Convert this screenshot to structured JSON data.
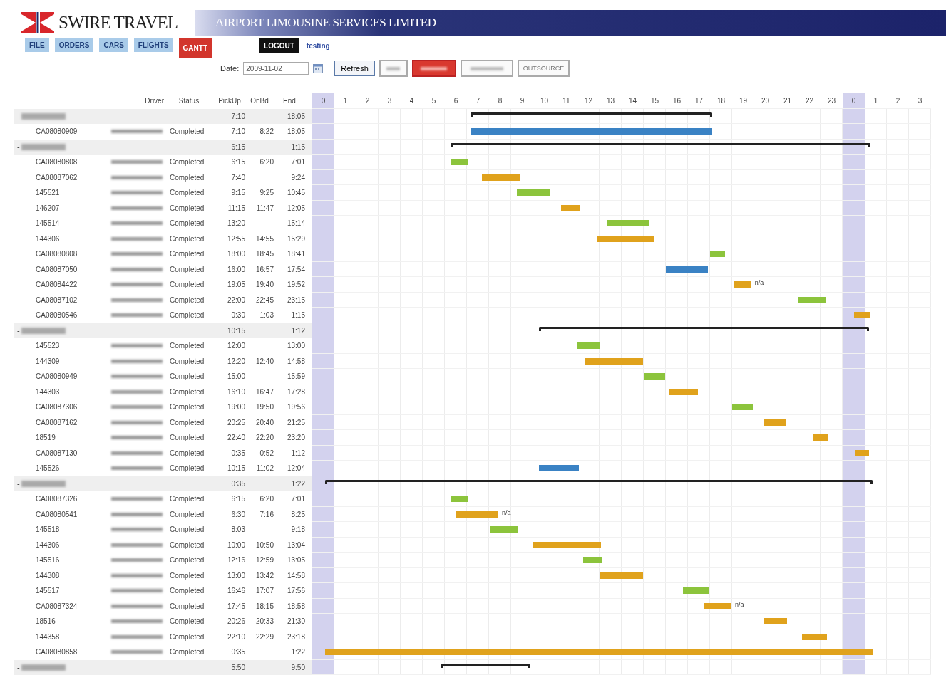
{
  "brand": {
    "name": "SWIRE TRAVEL",
    "banner": "AIRPORT LIMOUSINE SERVICES LIMITED"
  },
  "tabs": [
    {
      "label": "FILE",
      "selected": false
    },
    {
      "label": "ORDERS",
      "selected": false
    },
    {
      "label": "CARS",
      "selected": false
    },
    {
      "label": "FLIGHTS",
      "selected": false
    },
    {
      "label": "GANTT",
      "selected": true
    }
  ],
  "logout": "LOGOUT",
  "user": "testing",
  "toolbar": {
    "date_label": "Date:",
    "date_value": "2009-11-02",
    "refresh": "Refresh",
    "outsource": "OUTSOURCE"
  },
  "columns": [
    "Driver",
    "Status",
    "PickUp",
    "OnBd",
    "End"
  ],
  "hours": [
    {
      "label": "0",
      "highlighted": true
    },
    {
      "label": "1",
      "highlighted": false
    },
    {
      "label": "2",
      "highlighted": false
    },
    {
      "label": "3",
      "highlighted": false
    },
    {
      "label": "4",
      "highlighted": false
    },
    {
      "label": "5",
      "highlighted": false
    },
    {
      "label": "6",
      "highlighted": false
    },
    {
      "label": "7",
      "highlighted": false
    },
    {
      "label": "8",
      "highlighted": false
    },
    {
      "label": "9",
      "highlighted": false
    },
    {
      "label": "10",
      "highlighted": false
    },
    {
      "label": "11",
      "highlighted": false
    },
    {
      "label": "12",
      "highlighted": false
    },
    {
      "label": "13",
      "highlighted": false
    },
    {
      "label": "14",
      "highlighted": false
    },
    {
      "label": "15",
      "highlighted": false
    },
    {
      "label": "16",
      "highlighted": false
    },
    {
      "label": "17",
      "highlighted": false
    },
    {
      "label": "18",
      "highlighted": false
    },
    {
      "label": "19",
      "highlighted": false
    },
    {
      "label": "20",
      "highlighted": false
    },
    {
      "label": "21",
      "highlighted": false
    },
    {
      "label": "22",
      "highlighted": false
    },
    {
      "label": "23",
      "highlighted": false
    },
    {
      "label": "0",
      "highlighted": true
    },
    {
      "label": "1",
      "highlighted": false
    },
    {
      "label": "2",
      "highlighted": false
    },
    {
      "label": "3",
      "highlighted": false
    }
  ],
  "groups": [
    {
      "toggle": "-",
      "pickup": "7:10",
      "end": "18:05",
      "rows": [
        {
          "id": "CA08080909",
          "status": "Completed",
          "pickup": "7:10",
          "onbd": "8:22",
          "end": "18:05",
          "color": "#3a82c4",
          "overnight": false
        }
      ]
    },
    {
      "toggle": "-",
      "pickup": "6:15",
      "end": "1:15",
      "rows": [
        {
          "id": "CA08080808",
          "status": "Completed",
          "pickup": "6:15",
          "onbd": "6:20",
          "end": "7:01",
          "color": "#8cc43c",
          "overnight": false
        },
        {
          "id": "CA08087062",
          "status": "Completed",
          "pickup": "7:40",
          "end": "9:24",
          "color": "#e0a21c",
          "overnight": false
        },
        {
          "id": "145521",
          "status": "Completed",
          "pickup": "9:15",
          "onbd": "9:25",
          "end": "10:45",
          "color": "#8cc43c",
          "overnight": false
        },
        {
          "id": "146207",
          "status": "Completed",
          "pickup": "11:15",
          "onbd": "11:47",
          "end": "12:05",
          "color": "#e0a21c",
          "overnight": false
        },
        {
          "id": "145514",
          "status": "Completed",
          "pickup": "13:20",
          "end": "15:14",
          "color": "#8cc43c",
          "overnight": false
        },
        {
          "id": "144306",
          "status": "Completed",
          "pickup": "12:55",
          "onbd": "14:55",
          "end": "15:29",
          "color": "#e0a21c",
          "overnight": false
        },
        {
          "id": "CA08080808",
          "status": "Completed",
          "pickup": "18:00",
          "onbd": "18:45",
          "end": "18:41",
          "color": "#8cc43c",
          "overnight": false
        },
        {
          "id": "CA08087050",
          "status": "Completed",
          "pickup": "16:00",
          "onbd": "16:57",
          "end": "17:54",
          "color": "#3a82c4",
          "overnight": false
        },
        {
          "id": "CA08084422",
          "status": "Completed",
          "pickup": "19:05",
          "onbd": "19:40",
          "end": "19:52",
          "color": "#e0a21c",
          "overnight": false,
          "note": "n/a"
        },
        {
          "id": "CA08087102",
          "status": "Completed",
          "pickup": "22:00",
          "onbd": "22:45",
          "end": "23:15",
          "color": "#8cc43c",
          "overnight": false
        },
        {
          "id": "CA08080546",
          "status": "Completed",
          "pickup": "0:30",
          "onbd": "1:03",
          "end": "1:15",
          "color": "#e0a21c",
          "overnight": false
        }
      ]
    },
    {
      "toggle": "-",
      "pickup": "10:15",
      "end": "1:12",
      "rows": [
        {
          "id": "145523",
          "status": "Completed",
          "pickup": "12:00",
          "end": "13:00",
          "color": "#8cc43c",
          "overnight": false
        },
        {
          "id": "144309",
          "status": "Completed",
          "pickup": "12:20",
          "onbd": "12:40",
          "end": "14:58",
          "color": "#e0a21c",
          "overnight": false
        },
        {
          "id": "CA08080949",
          "status": "Completed",
          "pickup": "15:00",
          "end": "15:59",
          "color": "#8cc43c",
          "overnight": false
        },
        {
          "id": "144303",
          "status": "Completed",
          "pickup": "16:10",
          "onbd": "16:47",
          "end": "17:28",
          "color": "#e0a21c",
          "overnight": false
        },
        {
          "id": "CA08087306",
          "status": "Completed",
          "pickup": "19:00",
          "onbd": "19:50",
          "end": "19:56",
          "color": "#8cc43c",
          "overnight": false
        },
        {
          "id": "CA08087162",
          "status": "Completed",
          "pickup": "20:25",
          "onbd": "20:40",
          "end": "21:25",
          "color": "#e0a21c",
          "overnight": false
        },
        {
          "id": "18519",
          "status": "Completed",
          "pickup": "22:40",
          "onbd": "22:20",
          "end": "23:20",
          "color": "#e0a21c",
          "overnight": false
        },
        {
          "id": "CA08087130",
          "status": "Completed",
          "pickup": "0:35",
          "onbd": "0:52",
          "end": "1:12",
          "color": "#e0a21c",
          "overnight": false
        },
        {
          "id": "145526",
          "status": "Completed",
          "pickup": "10:15",
          "onbd": "11:02",
          "end": "12:04",
          "color": "#3a82c4",
          "overnight": false
        }
      ]
    },
    {
      "toggle": "-",
      "pickup": "0:35",
      "end": "1:22",
      "rows": [
        {
          "id": "CA08087326",
          "status": "Completed",
          "pickup": "6:15",
          "onbd": "6:20",
          "end": "7:01",
          "color": "#8cc43c",
          "overnight": false
        },
        {
          "id": "CA08080541",
          "status": "Completed",
          "pickup": "6:30",
          "onbd": "7:16",
          "end": "8:25",
          "color": "#e0a21c",
          "overnight": false,
          "note": "n/a"
        },
        {
          "id": "145518",
          "status": "Completed",
          "pickup": "8:03",
          "end": "9:18",
          "color": "#8cc43c",
          "overnight": false
        },
        {
          "id": "144306",
          "status": "Completed",
          "pickup": "10:00",
          "onbd": "10:50",
          "end": "13:04",
          "color": "#e0a21c",
          "overnight": false
        },
        {
          "id": "145516",
          "status": "Completed",
          "pickup": "12:16",
          "onbd": "12:59",
          "end": "13:05",
          "color": "#8cc43c",
          "overnight": false
        },
        {
          "id": "144308",
          "status": "Completed",
          "pickup": "13:00",
          "onbd": "13:42",
          "end": "14:58",
          "color": "#e0a21c",
          "overnight": false
        },
        {
          "id": "145517",
          "status": "Completed",
          "pickup": "16:46",
          "onbd": "17:07",
          "end": "17:56",
          "color": "#8cc43c",
          "overnight": false
        },
        {
          "id": "CA08087324",
          "status": "Completed",
          "pickup": "17:45",
          "onbd": "18:15",
          "end": "18:58",
          "color": "#e0a21c",
          "overnight": false,
          "note": "n/a"
        },
        {
          "id": "18516",
          "status": "Completed",
          "pickup": "20:26",
          "onbd": "20:33",
          "end": "21:30",
          "color": "#e0a21c",
          "overnight": false
        },
        {
          "id": "144358",
          "status": "Completed",
          "pickup": "22:10",
          "onbd": "22:29",
          "end": "23:18",
          "color": "#e0a21c",
          "overnight": false
        },
        {
          "id": "CA08080858",
          "status": "Completed",
          "pickup": "0:35",
          "end": "1:22",
          "color": "#e0a21c",
          "overnight": true
        }
      ]
    },
    {
      "toggle": "-",
      "pickup": "5:50",
      "end": "9:50"
    }
  ]
}
